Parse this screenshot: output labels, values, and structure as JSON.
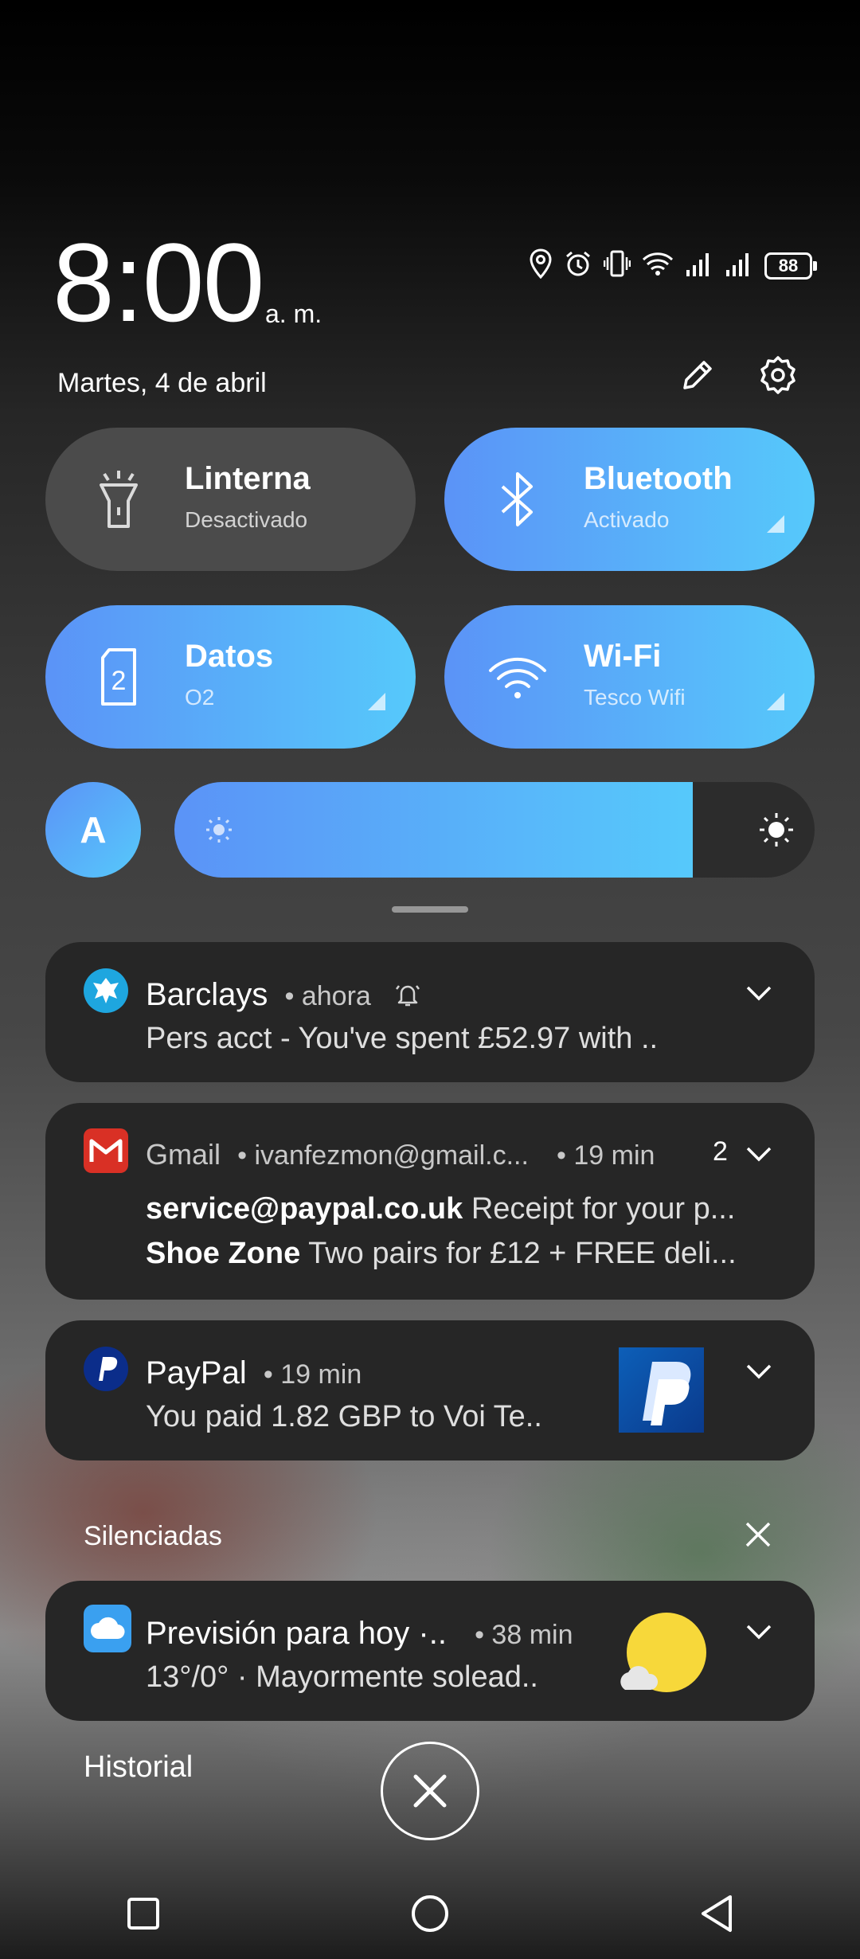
{
  "header": {
    "time": "8:00",
    "ampm": "a. m.",
    "date": "Martes, 4 de abril",
    "battery": "88"
  },
  "tiles": [
    {
      "title": "Linterna",
      "subtitle": "Desactivado"
    },
    {
      "title": "Bluetooth",
      "subtitle": "Activado"
    },
    {
      "title": "Datos",
      "subtitle": "O2"
    },
    {
      "title": "Wi-Fi",
      "subtitle": "Tesco Wifi"
    }
  ],
  "brightness": {
    "auto_label": "A",
    "level": 0.81
  },
  "notifications": {
    "barclays": {
      "app": "Barclays",
      "time": "• ahora",
      "text": "Pers acct - You've spent £52.97 with .."
    },
    "gmail": {
      "app": "Gmail",
      "account": "• ivanfezmon@gmail.c...",
      "time": "• 19 min",
      "count": "2",
      "lines": [
        {
          "sender": "service@paypal.co.uk",
          "text": "Receipt for your p..."
        },
        {
          "sender": "Shoe Zone",
          "text": "Two pairs for £12 + FREE deli..."
        }
      ]
    },
    "paypal": {
      "app": "PayPal",
      "time": "• 19 min",
      "text": "You paid 1.82 GBP to Voi Te.."
    },
    "silenced_label": "Silenciadas",
    "weather": {
      "app": "Previsión para hoy ·..",
      "time": "• 38 min",
      "text": "13°/0° · Mayormente solead.."
    }
  },
  "footer": {
    "history": "Historial"
  },
  "colors": {
    "accent_start": "#5b93f7",
    "accent_end": "#56c9fb",
    "card": "#262626"
  }
}
